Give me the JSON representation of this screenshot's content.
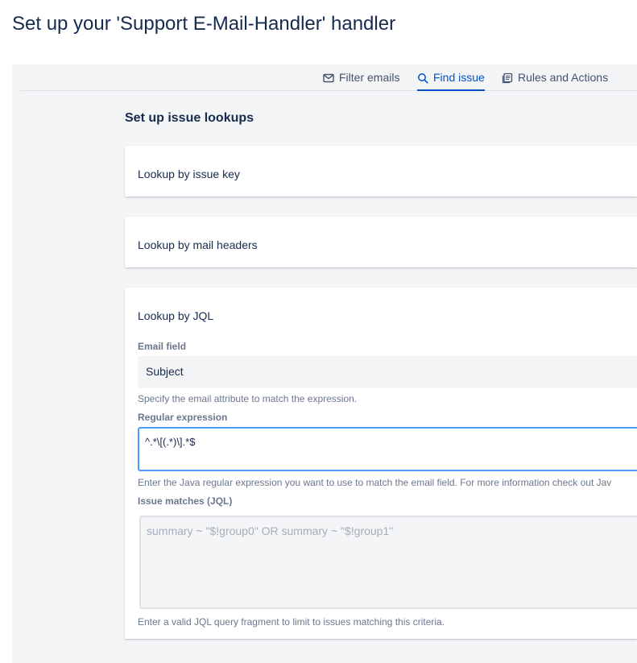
{
  "page": {
    "title": "Set up your 'Support E-Mail-Handler' handler"
  },
  "tabs": [
    {
      "label": "Filter emails",
      "icon": "mail-icon",
      "active": false
    },
    {
      "label": "Find issue",
      "icon": "search-icon",
      "active": true
    },
    {
      "label": "Rules and Actions",
      "icon": "rules-icon",
      "active": false
    }
  ],
  "section": {
    "title": "Set up issue lookups"
  },
  "lookups": {
    "issue_key": {
      "label": "Lookup by issue key"
    },
    "mail_headers": {
      "label": "Lookup by mail headers"
    },
    "jql": {
      "label": "Lookup by JQL",
      "email_field": {
        "label": "Email field",
        "value": "Subject",
        "helper": "Specify the email attribute to match the expression."
      },
      "regex": {
        "label": "Regular expression",
        "value": "^.*\\[(.*)\\].*$",
        "helper": "Enter the Java regular expression you want to use to match the email field. For more information check out Jav"
      },
      "issue_matches": {
        "label": "Issue matches (JQL)",
        "placeholder": "summary ~ \"$!group0\" OR summary ~ \"$!group1\"",
        "helper": "Enter a valid JQL query fragment to limit to issues matching this criteria."
      }
    }
  },
  "colors": {
    "accent": "#0052cc",
    "focus_border": "#4c9aff",
    "panel_bg": "#f4f5f7"
  }
}
